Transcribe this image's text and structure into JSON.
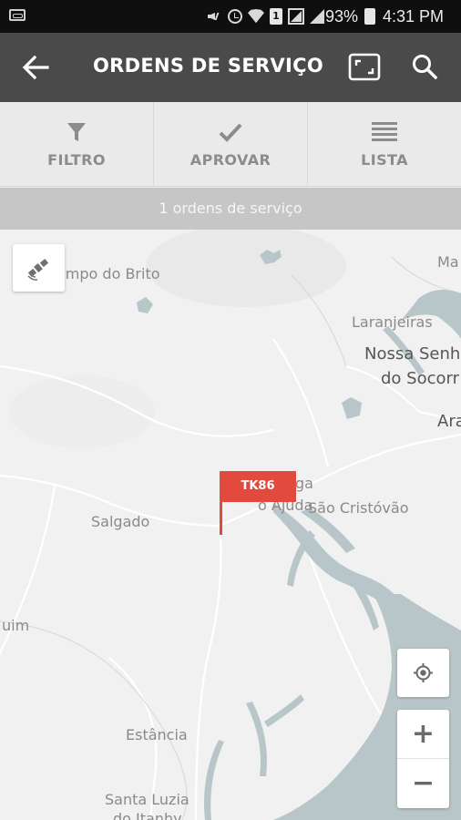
{
  "status_bar": {
    "battery": "93%",
    "time": "4:31 PM",
    "sim_badge": "1"
  },
  "app_bar": {
    "title": "ORDENS DE SERVIÇO",
    "icons": [
      "back-arrow-icon",
      "expand-icon",
      "search-icon"
    ]
  },
  "toolbar": {
    "items": [
      {
        "label": "FILTRO",
        "icon": "filter-icon"
      },
      {
        "label": "APROVAR",
        "icon": "check-icon"
      },
      {
        "label": "LISTA",
        "icon": "list-icon"
      }
    ]
  },
  "count_bar": {
    "text": "1 ordens de serviço"
  },
  "map": {
    "labels": {
      "campo_do_brito": "ampo do Brito",
      "ma": "Ma",
      "laranjeiras": "Laranjeiras",
      "nossa_senhora_1": "Nossa Senh",
      "nossa_senhora_2": "do Socorr",
      "ara": "Ara",
      "salgado": "Salgado",
      "aga": "ga",
      "ajuda": "o Ajuda",
      "sao_cristovao": "São Cristóvão",
      "uim": "uim",
      "estancia": "Estância",
      "santa_luzia_1": "Santa Luzia",
      "santa_luzia_2": "do Itanhy"
    },
    "marker_label": "TK86",
    "colors": {
      "land": "#f1f1f1",
      "water": "#b8c6c9",
      "road": "#ffffff",
      "marker": "#e14a3d"
    },
    "controls": {
      "zoom_in": "+",
      "zoom_out": "−"
    }
  }
}
